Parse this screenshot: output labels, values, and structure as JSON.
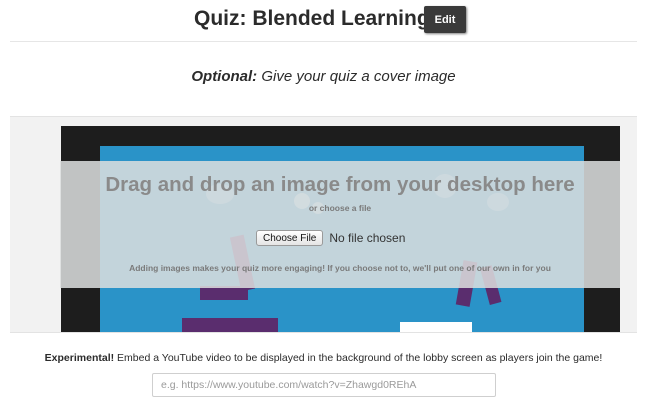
{
  "header": {
    "title": "Quiz: Blended Learning",
    "edit_label": "Edit"
  },
  "cover": {
    "optional_label": "Optional:",
    "prompt": "Give your quiz a cover image",
    "drop_title": "Drag and drop an image from your desktop here",
    "or_choose": "or choose a file",
    "choose_file_label": "Choose File",
    "no_file_text": "No file chosen",
    "note": "Adding images makes your quiz more engaging! If you choose not to, we'll put one of our own in for you"
  },
  "video": {
    "experimental_label": "Experimental!",
    "description": "Embed a YouTube video to be displayed in the background of the lobby screen as players join the game!",
    "placeholder": "e.g. https://www.youtube.com/watch?v=Zhawgd0REhA",
    "value": ""
  },
  "colors": {
    "art_background": "#2a93c8",
    "figure": "#5a2d6e",
    "frame": "#1d1d1d"
  }
}
